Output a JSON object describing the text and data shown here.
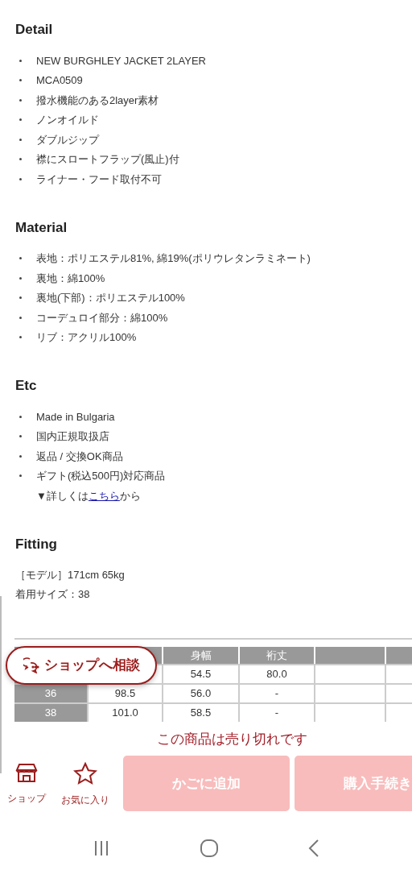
{
  "sections": [
    {
      "title": "Detail",
      "items": [
        {
          "kind": "bullet",
          "text": "NEW BURGHLEY JACKET 2LAYER"
        },
        {
          "kind": "bullet",
          "text": "MCA0509"
        },
        {
          "kind": "bullet",
          "text": "撥水機能のある2layer素材"
        },
        {
          "kind": "bullet",
          "text": "ノンオイルド"
        },
        {
          "kind": "bullet",
          "text": "ダブルジップ"
        },
        {
          "kind": "bullet",
          "text": "襟にスロートフラップ(風止)付"
        },
        {
          "kind": "bullet",
          "text": "ライナー・フード取付不可"
        }
      ]
    },
    {
      "title": "Material",
      "items": [
        {
          "kind": "bullet",
          "text": "表地：ポリエステル81%, 綿19%(ポリウレタンラミネート)"
        },
        {
          "kind": "bullet",
          "text": "裏地：綿100%"
        },
        {
          "kind": "bullet",
          "text": "裏地(下部)：ポリエステル100%"
        },
        {
          "kind": "bullet",
          "text": "コーデュロイ部分：綿100%"
        },
        {
          "kind": "bullet",
          "text": "リブ：アクリル100%"
        }
      ]
    },
    {
      "title": "Etc",
      "items": [
        {
          "kind": "bullet",
          "text": "Made in Bulgaria"
        },
        {
          "kind": "bullet",
          "text": "国内正規取扱店"
        },
        {
          "kind": "bullet",
          "text": "返品 / 交換OK商品"
        },
        {
          "kind": "bullet",
          "text": "ギフト(税込500円)対応商品"
        },
        {
          "kind": "note",
          "before": "▼詳しくは",
          "link": "こちら",
          "after": "から"
        }
      ]
    }
  ],
  "fitting": {
    "title": "Fitting",
    "lines": [
      "［モデル］171cm 65kg",
      "着用サイズ：38"
    ]
  },
  "size_table": {
    "header": {
      "column_3": "身幅",
      "column_4": "裄丈"
    },
    "rows": [
      {
        "column_3": "54.5",
        "column_4": "80.0"
      },
      {
        "column_1": "36",
        "column_2": "98.5",
        "column_3": "56.0",
        "column_4": "-"
      },
      {
        "column_1": "38",
        "column_2": "101.0",
        "column_3": "58.5",
        "column_4": "-"
      }
    ]
  },
  "consult_button": {
    "label": "ショップへ相談"
  },
  "sold_out_message": "この商品は売り切れです",
  "bottom_bar": {
    "icons": [
      {
        "kind": "shop",
        "label": "ショップ"
      },
      {
        "kind": "favorite",
        "label": "お気に入り"
      }
    ],
    "buttons": [
      {
        "label": "かごに追加",
        "disabled": true
      },
      {
        "label": "購入手続き",
        "disabled": true
      }
    ]
  }
}
